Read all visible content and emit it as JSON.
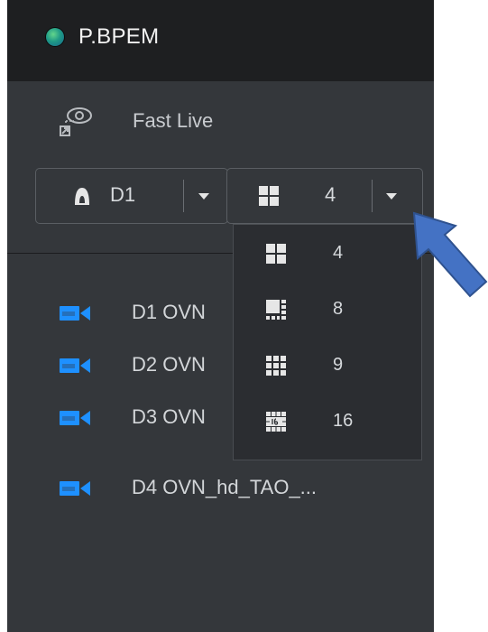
{
  "header": {
    "device_name": "P.BPEM",
    "status_color": "#2aa07f"
  },
  "fast_live": {
    "label": "Fast Live",
    "icon": "fast-live-icon"
  },
  "device_select": {
    "value": "D1",
    "icon": "person-silhouette-icon"
  },
  "split_select": {
    "value": "4",
    "icon": "grid-4-icon"
  },
  "split_options": [
    {
      "value": "4",
      "icon": "grid-4-icon"
    },
    {
      "value": "8",
      "icon": "grid-8-icon"
    },
    {
      "value": "9",
      "icon": "grid-9-icon"
    },
    {
      "value": "16",
      "icon": "grid-16-icon"
    }
  ],
  "channels": [
    {
      "label": "D1 OVN",
      "icon": "camera-icon"
    },
    {
      "label": "D2 OVN",
      "icon": "camera-icon"
    },
    {
      "label": "D3 OVN",
      "icon": "camera-icon"
    },
    {
      "label": "D4 OVN_hd_TAO_...",
      "icon": "camera-icon"
    }
  ],
  "annotation": {
    "arrow_color": "#4472c4"
  },
  "colors": {
    "accent": "#1e90ff",
    "panel": "#34373b",
    "header": "#1e1f21"
  }
}
